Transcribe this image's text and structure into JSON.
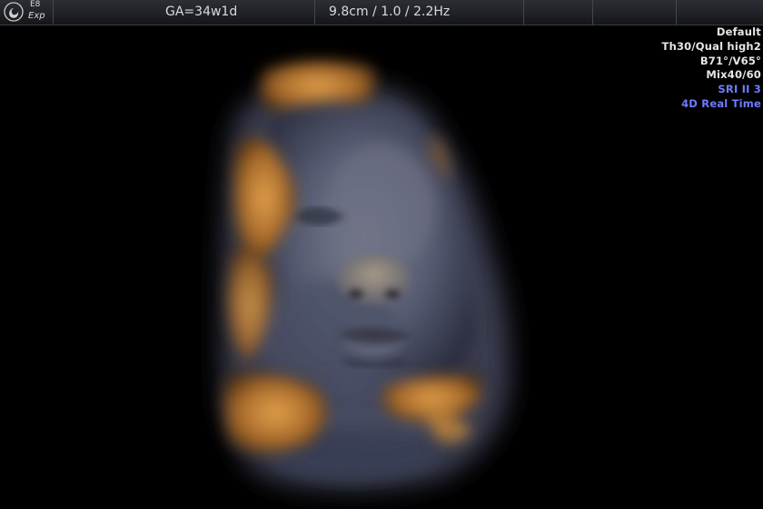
{
  "topbar": {
    "logo_icon": "ge-logo-icon",
    "probe": "E8",
    "mode": "Exp",
    "gestational_age": "GA=34w1d",
    "depth_settings": "9.8cm / 1.0 / 2.2Hz"
  },
  "params": {
    "preset": "Default",
    "quality": "Th30/Qual high2",
    "angles": "B71°/V65°",
    "mix": "Mix40/60",
    "sri": "SRI II 3",
    "realtime": "4D Real Time"
  },
  "colors": {
    "background": "#000000",
    "highlight_text": "#6f7cff",
    "tissue_gold": "#c98a3a",
    "tissue_blue": "#5a6078"
  }
}
